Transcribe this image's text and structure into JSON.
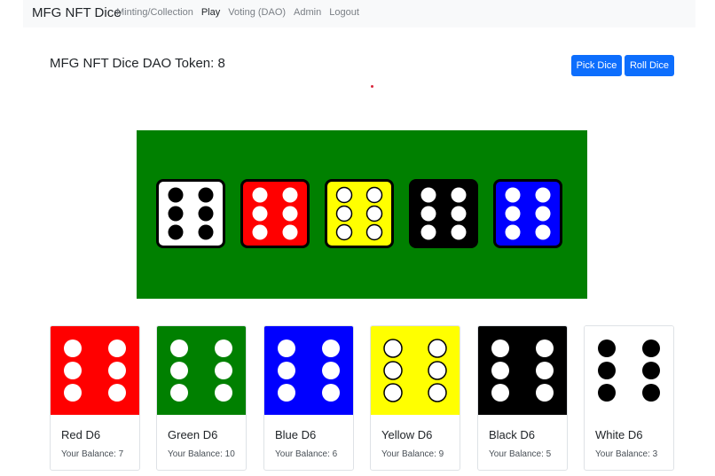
{
  "nav": {
    "brand": "MFG NFT Dice",
    "links": [
      {
        "label": "Minting/Collection",
        "active": false
      },
      {
        "label": "Play",
        "active": true
      },
      {
        "label": "Voting (DAO)",
        "active": false
      },
      {
        "label": "Admin",
        "active": false
      },
      {
        "label": "Logout",
        "active": false
      }
    ]
  },
  "header": {
    "title": "MFG NFT Dice DAO Token: 8",
    "pick_label": "Pick Dice",
    "roll_label": "Roll Dice",
    "button_color": "#0d6efd"
  },
  "table": {
    "color": "#008000",
    "dice": [
      {
        "color": "white",
        "face": "#ffffff",
        "pip": "#000000",
        "pip_style": "solid",
        "value": 6
      },
      {
        "color": "red",
        "face": "#ff0000",
        "pip": "#ffffff",
        "pip_style": "solid",
        "value": 6
      },
      {
        "color": "yellow",
        "face": "#ffff00",
        "pip": "#ffffff",
        "pip_style": "outlined",
        "value": 6
      },
      {
        "color": "black",
        "face": "#000000",
        "pip": "#ffffff",
        "pip_style": "solid",
        "value": 6
      },
      {
        "color": "blue",
        "face": "#0000ff",
        "pip": "#ffffff",
        "pip_style": "solid",
        "value": 6
      }
    ]
  },
  "cards": [
    {
      "title": "Red D6",
      "balance": "Your Balance: 7",
      "face": "#ff0000",
      "pip": "#ffffff",
      "pip_style": "solid"
    },
    {
      "title": "Green D6",
      "balance": "Your Balance: 10",
      "face": "#008000",
      "pip": "#ffffff",
      "pip_style": "solid"
    },
    {
      "title": "Blue D6",
      "balance": "Your Balance: 6",
      "face": "#0000ff",
      "pip": "#ffffff",
      "pip_style": "solid"
    },
    {
      "title": "Yellow D6",
      "balance": "Your Balance: 9",
      "face": "#ffff00",
      "pip": "#ffffff",
      "pip_style": "outlined"
    },
    {
      "title": "Black D6",
      "balance": "Your Balance: 5",
      "face": "#000000",
      "pip": "#ffffff",
      "pip_style": "solid"
    },
    {
      "title": "White D6",
      "balance": "Your Balance: 3",
      "face": "#ffffff",
      "pip": "#000000",
      "pip_style": "solid"
    }
  ]
}
